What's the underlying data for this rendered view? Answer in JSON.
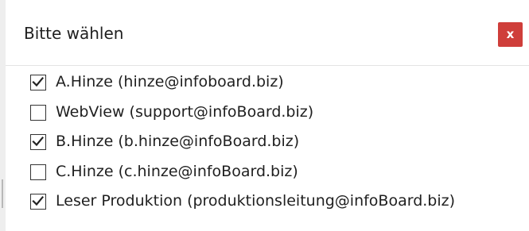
{
  "dialog": {
    "title": "Bitte wählen",
    "close_label": "x",
    "close_color": "#cf3e3a"
  },
  "options": [
    {
      "label": "A.Hinze (hinze@infoboard.biz)",
      "checked": true
    },
    {
      "label": "WebView (support@infoBoard.biz)",
      "checked": false
    },
    {
      "label": "B.Hinze (b.hinze@infoBoard.biz)",
      "checked": true
    },
    {
      "label": "C.Hinze (c.hinze@infoBoard.biz)",
      "checked": false
    },
    {
      "label": "Leser Produktion (produktionsleitung@infoBoard.biz)",
      "checked": true
    }
  ]
}
